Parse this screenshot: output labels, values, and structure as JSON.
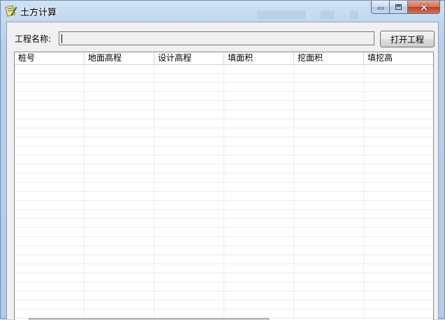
{
  "window": {
    "title": "土方计算",
    "controls": {
      "minimize_icon": "minimize-icon",
      "maximize_icon": "maximize-icon",
      "close_icon": "close-icon"
    }
  },
  "form": {
    "project_name_label": "工程名称:",
    "project_name_value": "",
    "open_button_label": "打开工程"
  },
  "table": {
    "columns": [
      "桩号",
      "地面高程",
      "设计高程",
      "填面积",
      "挖面积",
      "填挖高"
    ],
    "rows": []
  },
  "colors": {
    "title_bar": "#c2d8ef",
    "client_background": "#f0f0f0",
    "close_button": "#c2401f",
    "grid_line": "#ececec"
  }
}
